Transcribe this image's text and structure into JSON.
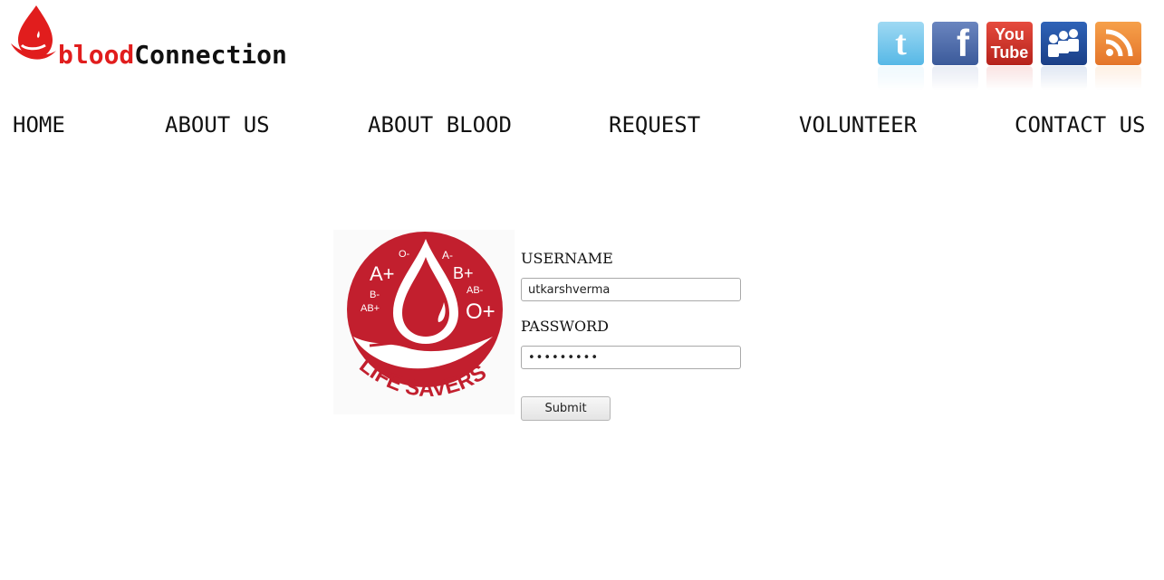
{
  "header": {
    "logo_part1": "blood",
    "logo_part2": "Connection",
    "brand_red": "#e11d1d"
  },
  "social": [
    {
      "name": "twitter",
      "glyph": "t"
    },
    {
      "name": "facebook",
      "glyph": "f"
    },
    {
      "name": "youtube",
      "glyph_top": "You",
      "glyph_bottom": "Tube"
    },
    {
      "name": "myspace",
      "glyph": "myspace-people-icon"
    },
    {
      "name": "rss",
      "glyph": "rss-icon"
    }
  ],
  "nav": {
    "items": [
      {
        "label": "HOME"
      },
      {
        "label": "ABOUT US"
      },
      {
        "label": "ABOUT BLOOD"
      },
      {
        "label": "REQUEST"
      },
      {
        "label": "VOLUNTEER"
      },
      {
        "label": "CONTACT US"
      }
    ]
  },
  "emblem": {
    "blood_types": [
      "O-",
      "A+",
      "A-",
      "B+",
      "B-",
      "AB-",
      "AB+",
      "O+"
    ],
    "caption": "LIFE SAVERS",
    "color": "#c21f2e"
  },
  "login": {
    "username_label": "USERNAME",
    "username_value": "utkarshverma",
    "password_label": "PASSWORD",
    "password_value": "•••••••••",
    "submit_label": "Submit"
  }
}
